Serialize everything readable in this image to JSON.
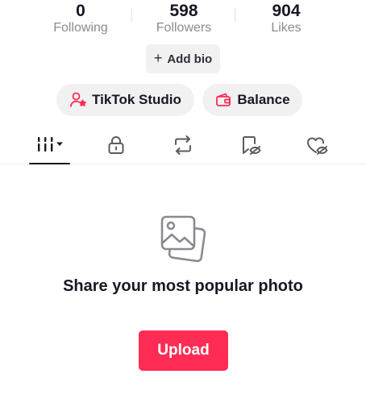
{
  "stats": {
    "following": {
      "value": "0",
      "label": "Following"
    },
    "followers": {
      "value": "598",
      "label": "Followers"
    },
    "likes": {
      "value": "904",
      "label": "Likes"
    }
  },
  "add_bio": {
    "label": "Add bio"
  },
  "actions": {
    "studio_label": "TikTok Studio",
    "balance_label": "Balance"
  },
  "tabs": [
    {
      "name": "videos",
      "icon": "grid-columns-icon",
      "active": true
    },
    {
      "name": "private",
      "icon": "lock-icon",
      "active": false
    },
    {
      "name": "reposts",
      "icon": "repost-icon",
      "active": false
    },
    {
      "name": "favorites",
      "icon": "bookmark-hidden-icon",
      "active": false
    },
    {
      "name": "liked",
      "icon": "heart-hidden-icon",
      "active": false
    }
  ],
  "empty_state": {
    "icon": "photo-stack-icon",
    "title": "Share your most popular photo",
    "button_label": "Upload"
  },
  "colors": {
    "accent": "#fe2c55",
    "text": "#161823",
    "muted": "#8a8b91",
    "pill_bg": "#f1f1f2"
  }
}
